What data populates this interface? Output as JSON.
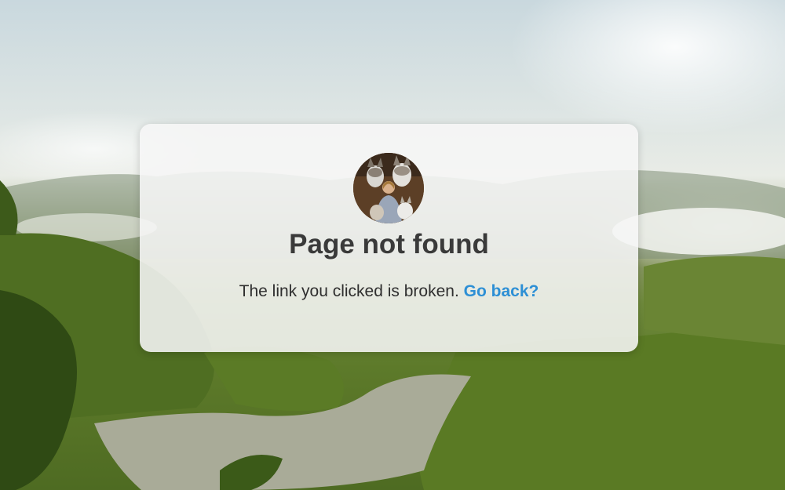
{
  "error_card": {
    "title": "Page not found",
    "message": "The link you clicked is broken.",
    "link_label": "Go back?",
    "link_color": "#2d8fd5",
    "avatar_icon": "avatar-photo-huskies"
  },
  "background": {
    "scene": "jungle-river-landscape",
    "colors": {
      "sky": "#dfe6e4",
      "forest": "#5d7a2a",
      "river": "#a9ab98"
    }
  }
}
